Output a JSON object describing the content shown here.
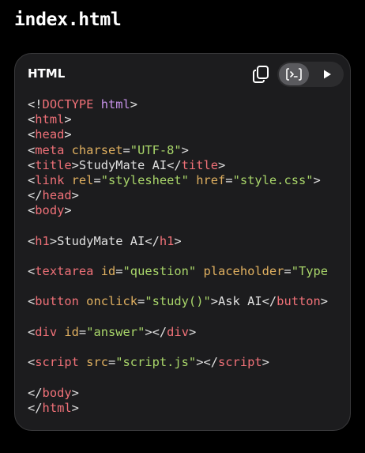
{
  "file_title": "index.html",
  "card": {
    "language": "HTML",
    "icons": {
      "copy": "copy-icon",
      "code_view": "code-view-icon",
      "run": "play-icon"
    }
  },
  "code_lines": [
    [
      {
        "t": "punc",
        "v": "<!"
      },
      {
        "t": "tag",
        "v": "DOCTYPE"
      },
      {
        "t": "txt",
        "v": " "
      },
      {
        "t": "kw",
        "v": "html"
      },
      {
        "t": "punc",
        "v": ">"
      }
    ],
    [
      {
        "t": "punc",
        "v": "<"
      },
      {
        "t": "tag",
        "v": "html"
      },
      {
        "t": "punc",
        "v": ">"
      }
    ],
    [
      {
        "t": "punc",
        "v": "<"
      },
      {
        "t": "tag",
        "v": "head"
      },
      {
        "t": "punc",
        "v": ">"
      }
    ],
    [
      {
        "t": "punc",
        "v": "<"
      },
      {
        "t": "tag",
        "v": "meta"
      },
      {
        "t": "txt",
        "v": " "
      },
      {
        "t": "attr",
        "v": "charset"
      },
      {
        "t": "punc",
        "v": "="
      },
      {
        "t": "str",
        "v": "\"UTF-8\""
      },
      {
        "t": "punc",
        "v": ">"
      }
    ],
    [
      {
        "t": "punc",
        "v": "<"
      },
      {
        "t": "tag",
        "v": "title"
      },
      {
        "t": "punc",
        "v": ">"
      },
      {
        "t": "txt",
        "v": "StudyMate AI"
      },
      {
        "t": "punc",
        "v": "</"
      },
      {
        "t": "tag",
        "v": "title"
      },
      {
        "t": "punc",
        "v": ">"
      }
    ],
    [
      {
        "t": "punc",
        "v": "<"
      },
      {
        "t": "tag",
        "v": "link"
      },
      {
        "t": "txt",
        "v": " "
      },
      {
        "t": "attr",
        "v": "rel"
      },
      {
        "t": "punc",
        "v": "="
      },
      {
        "t": "str",
        "v": "\"stylesheet\""
      },
      {
        "t": "txt",
        "v": " "
      },
      {
        "t": "attr",
        "v": "href"
      },
      {
        "t": "punc",
        "v": "="
      },
      {
        "t": "str",
        "v": "\"style.css\""
      },
      {
        "t": "punc",
        "v": ">"
      }
    ],
    [
      {
        "t": "punc",
        "v": "</"
      },
      {
        "t": "tag",
        "v": "head"
      },
      {
        "t": "punc",
        "v": ">"
      }
    ],
    [
      {
        "t": "punc",
        "v": "<"
      },
      {
        "t": "tag",
        "v": "body"
      },
      {
        "t": "punc",
        "v": ">"
      }
    ],
    [],
    [
      {
        "t": "punc",
        "v": "<"
      },
      {
        "t": "tag",
        "v": "h1"
      },
      {
        "t": "punc",
        "v": ">"
      },
      {
        "t": "txt",
        "v": "StudyMate AI"
      },
      {
        "t": "punc",
        "v": "</"
      },
      {
        "t": "tag",
        "v": "h1"
      },
      {
        "t": "punc",
        "v": ">"
      }
    ],
    [],
    [
      {
        "t": "punc",
        "v": "<"
      },
      {
        "t": "tag",
        "v": "textarea"
      },
      {
        "t": "txt",
        "v": " "
      },
      {
        "t": "attr",
        "v": "id"
      },
      {
        "t": "punc",
        "v": "="
      },
      {
        "t": "str",
        "v": "\"question\""
      },
      {
        "t": "txt",
        "v": " "
      },
      {
        "t": "attr",
        "v": "placeholder"
      },
      {
        "t": "punc",
        "v": "="
      },
      {
        "t": "str",
        "v": "\"Type"
      }
    ],
    [],
    [
      {
        "t": "punc",
        "v": "<"
      },
      {
        "t": "tag",
        "v": "button"
      },
      {
        "t": "txt",
        "v": " "
      },
      {
        "t": "attr",
        "v": "onclick"
      },
      {
        "t": "punc",
        "v": "="
      },
      {
        "t": "str",
        "v": "\"study()\""
      },
      {
        "t": "punc",
        "v": ">"
      },
      {
        "t": "txt",
        "v": "Ask AI"
      },
      {
        "t": "punc",
        "v": "</"
      },
      {
        "t": "tag",
        "v": "button"
      },
      {
        "t": "punc",
        "v": ">"
      }
    ],
    [],
    [
      {
        "t": "punc",
        "v": "<"
      },
      {
        "t": "tag",
        "v": "div"
      },
      {
        "t": "txt",
        "v": " "
      },
      {
        "t": "attr",
        "v": "id"
      },
      {
        "t": "punc",
        "v": "="
      },
      {
        "t": "str",
        "v": "\"answer\""
      },
      {
        "t": "punc",
        "v": "></"
      },
      {
        "t": "tag",
        "v": "div"
      },
      {
        "t": "punc",
        "v": ">"
      }
    ],
    [],
    [
      {
        "t": "punc",
        "v": "<"
      },
      {
        "t": "tag",
        "v": "script"
      },
      {
        "t": "txt",
        "v": " "
      },
      {
        "t": "attr",
        "v": "src"
      },
      {
        "t": "punc",
        "v": "="
      },
      {
        "t": "str",
        "v": "\"script.js\""
      },
      {
        "t": "punc",
        "v": "></"
      },
      {
        "t": "tag",
        "v": "script"
      },
      {
        "t": "punc",
        "v": ">"
      }
    ],
    [],
    [
      {
        "t": "punc",
        "v": "</"
      },
      {
        "t": "tag",
        "v": "body"
      },
      {
        "t": "punc",
        "v": ">"
      }
    ],
    [
      {
        "t": "punc",
        "v": "</"
      },
      {
        "t": "tag",
        "v": "html"
      },
      {
        "t": "punc",
        "v": ">"
      }
    ]
  ],
  "colors": {
    "background": "#000000",
    "card": "#1c1c1e",
    "tag": "#f07178",
    "attribute": "#e0b060",
    "string": "#a9d66a",
    "keyword": "#c792ea"
  }
}
